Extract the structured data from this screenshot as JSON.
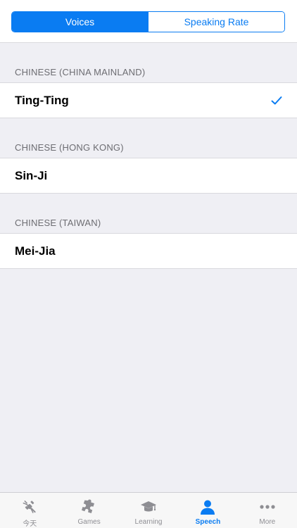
{
  "segmented": {
    "voices_label": "Voices",
    "rate_label": "Speaking Rate",
    "selected": "Voices"
  },
  "sections": [
    {
      "header": "CHINESE (CHINA MAINLAND)",
      "item": "Ting-Ting",
      "checked": true
    },
    {
      "header": "CHINESE (HONG KONG)",
      "item": "Sin-Ji",
      "checked": false
    },
    {
      "header": "CHINESE (TAIWAN)",
      "item": "Mei-Jia",
      "checked": false
    }
  ],
  "tabbar": {
    "tabs": [
      {
        "label": "今天",
        "icon": "satellite-icon"
      },
      {
        "label": "Games",
        "icon": "puzzle-icon"
      },
      {
        "label": "Learning",
        "icon": "graduation-cap-icon"
      },
      {
        "label": "Speech",
        "icon": "person-icon",
        "active": true
      },
      {
        "label": "More",
        "icon": "more-dots-icon"
      }
    ]
  },
  "colors": {
    "accent": "#0a7cf2",
    "background": "#efeff4",
    "inactive_tab": "#8e8e93"
  }
}
